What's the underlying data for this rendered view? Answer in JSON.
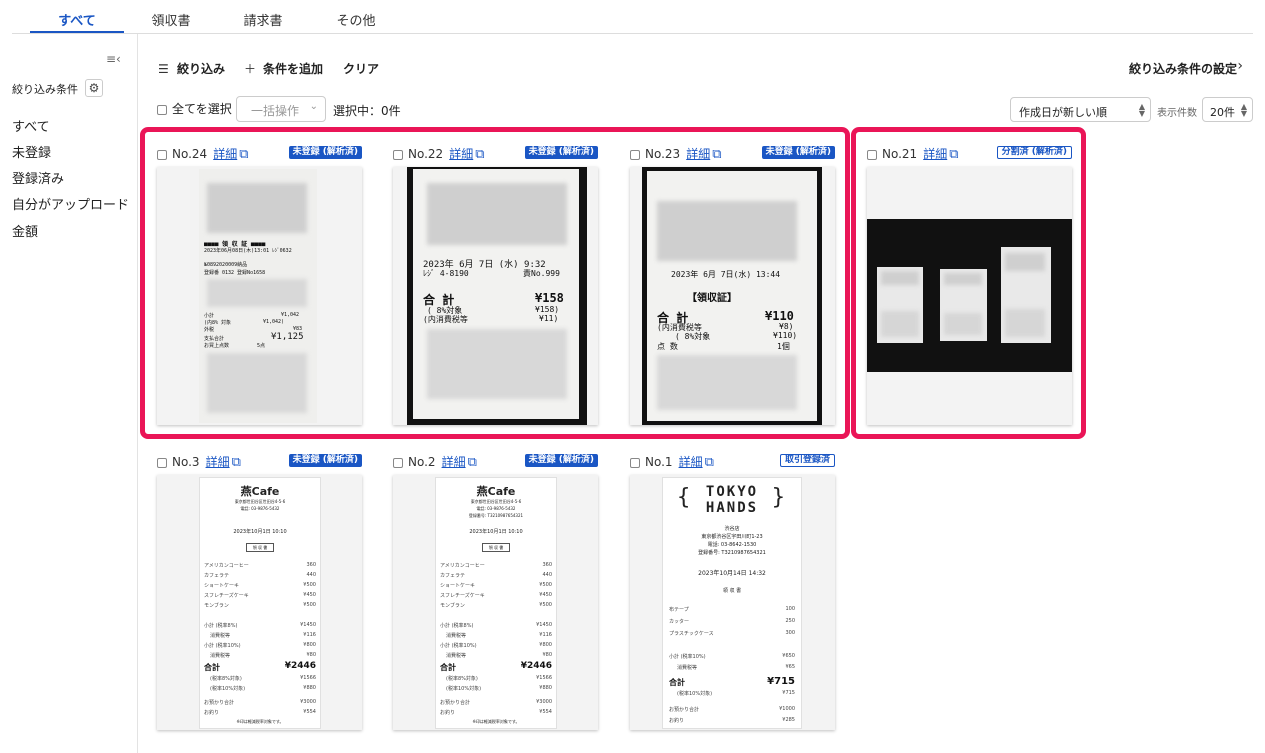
{
  "tabs": [
    "すべて",
    "領収書",
    "請求書",
    "その他"
  ],
  "sidebar": {
    "title": "絞り込み条件",
    "items": [
      "すべて",
      "未登録",
      "登録済み",
      "自分がアップロード",
      "金額"
    ]
  },
  "toolbar": {
    "filter": "絞り込み",
    "add_condition": "条件を追加",
    "clear": "クリア",
    "filter_settings": "絞り込み条件の設定"
  },
  "selection": {
    "select_all": "全てを選択",
    "bulk_action": "一括操作",
    "selected": "選択中：0件"
  },
  "sort": {
    "value": "作成日が新しい順",
    "per_page_label": "表示件数",
    "per_page": "20件"
  },
  "colors": {
    "accent": "#1a56c4",
    "highlight": "#ea1557"
  },
  "cards": [
    {
      "no": "No.24",
      "detail": "詳細",
      "badge": "未登録 (解析済)"
    },
    {
      "no": "No.22",
      "detail": "詳細",
      "badge": "未登録 (解析済)"
    },
    {
      "no": "No.23",
      "detail": "詳細",
      "badge": "未登録 (解析済)"
    },
    {
      "no": "No.21",
      "detail": "詳細",
      "badge": "分割済 (解析済)"
    },
    {
      "no": "No.3",
      "detail": "詳細",
      "badge": "未登録 (解析済)"
    },
    {
      "no": "No.2",
      "detail": "詳細",
      "badge": "未登録 (解析済)"
    },
    {
      "no": "No.1",
      "detail": "詳細",
      "badge": "取引登録済"
    }
  ],
  "receipts": {
    "r24": [
      "■■■■ 領 収 証 ■■■■",
      "2023年06月08日(木)13:01  ﾚｼﾞ0632",
      "№0892020009納品",
      "登録番 0132  登録No1658",
      "小計",
      "¥1,042",
      "(内8% 対象",
      "¥1,042)",
      "外税",
      "¥83",
      "支払合計",
      "¥1,125",
      "お買上点数",
      "5点"
    ],
    "r22": [
      "2023年 6月 7日 (水)  9:32",
      "ﾚｼﾞ 4-8190",
      "責No.999",
      "合 計",
      "¥158",
      "( 8%対象",
      "¥158)",
      "(内消費税等",
      "¥11)"
    ],
    "r23": [
      "2023年 6月 7日(水) 13:44",
      "【領収証】",
      "合  計",
      "¥110",
      "(内消費税等",
      "¥8)",
      "( 8%対象",
      "¥110)",
      "点   数",
      "1個"
    ],
    "cafe": {
      "name": "燕Cafe",
      "address": "東京都世田谷区世田谷4-5-6",
      "tel": "電話: 03-9876-5432",
      "regno": "登録番号: T3210987654321",
      "datetime": "2023年10月1日  10:10",
      "title": "領 収 書",
      "items": [
        [
          "アメリカンコーヒー",
          "360"
        ],
        [
          "カフェラテ",
          "440"
        ],
        [
          "ショートケーキ",
          "¥500"
        ],
        [
          "スフレチーズケーキ",
          "¥450"
        ],
        [
          "モンブラン",
          "¥500"
        ]
      ],
      "sub8": [
        "小計 (税率8%)",
        "¥1450"
      ],
      "tax8": [
        "消費税等",
        "¥116"
      ],
      "sub10": [
        "小計 (税率10%)",
        "¥800"
      ],
      "tax10": [
        "消費税等",
        "¥80"
      ],
      "total": [
        "合計",
        "¥2446"
      ],
      "t8": [
        "(税率8%対象)",
        "¥1566"
      ],
      "t10": [
        "(税率10%対象)",
        "¥880"
      ],
      "paid": [
        "お預かり合計",
        "¥3000"
      ],
      "change": [
        "お釣り",
        "¥554"
      ],
      "note": "※印は軽減税率対象です。"
    },
    "hands": {
      "logo1": "TOKYO",
      "logo2": "HANDS",
      "store": "渋谷店",
      "address": "東京都渋谷区宇田川町1-23",
      "tel": "電話: 03-8642-1530",
      "regno": "登録番号: T3210987654321",
      "datetime": "2023年10月14日  14:32",
      "title": "領 収 書",
      "items": [
        [
          "布テープ",
          "100"
        ],
        [
          "カッター",
          "250"
        ],
        [
          "プラスチックケース",
          "300"
        ]
      ],
      "sub": [
        "小計 (税率10%)",
        "¥650"
      ],
      "tax": [
        "消費税等",
        "¥65"
      ],
      "total": [
        "合計",
        "¥715"
      ],
      "t10": [
        "(税率10%対象)",
        "¥715"
      ],
      "paid": [
        "お預かり合計",
        "¥1000"
      ],
      "change": [
        "お釣り",
        "¥285"
      ]
    }
  }
}
